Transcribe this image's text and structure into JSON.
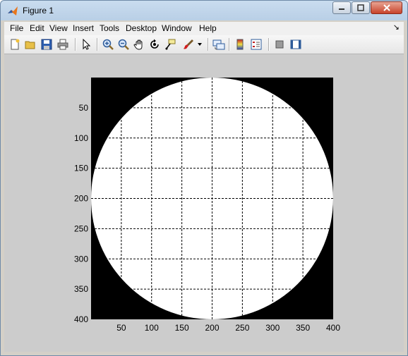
{
  "window": {
    "title": "Figure 1"
  },
  "menu": {
    "items": [
      "File",
      "Edit",
      "View",
      "Insert",
      "Tools",
      "Desktop",
      "Window",
      "Help"
    ],
    "dock_arrow": "↘"
  },
  "toolbar": {
    "icons": [
      "new-figure-icon",
      "open-file-icon",
      "save-icon",
      "print-icon",
      "pointer-icon",
      "zoom-in-icon",
      "zoom-out-icon",
      "pan-icon",
      "rotate-3d-icon",
      "data-cursor-icon",
      "brush-icon",
      "brush-dropdown-icon",
      "link-plot-icon",
      "colorbar-icon",
      "legend-icon",
      "hide-plot-tools-icon",
      "show-plot-tools-icon"
    ]
  },
  "chart_data": {
    "type": "image",
    "description_free": true,
    "xlim": [
      0,
      400
    ],
    "ylim": [
      0,
      400
    ],
    "x_ticks": [
      50,
      100,
      150,
      200,
      250,
      300,
      350,
      400
    ],
    "y_ticks": [
      50,
      100,
      150,
      200,
      250,
      300,
      350,
      400
    ],
    "y_direction": "reverse",
    "grid": true,
    "grid_style": "dashed",
    "image": {
      "shape": "disk",
      "center": [
        200,
        200
      ],
      "radius": 200,
      "inside_color": "#ffffff",
      "outside_color": "#000000"
    }
  }
}
